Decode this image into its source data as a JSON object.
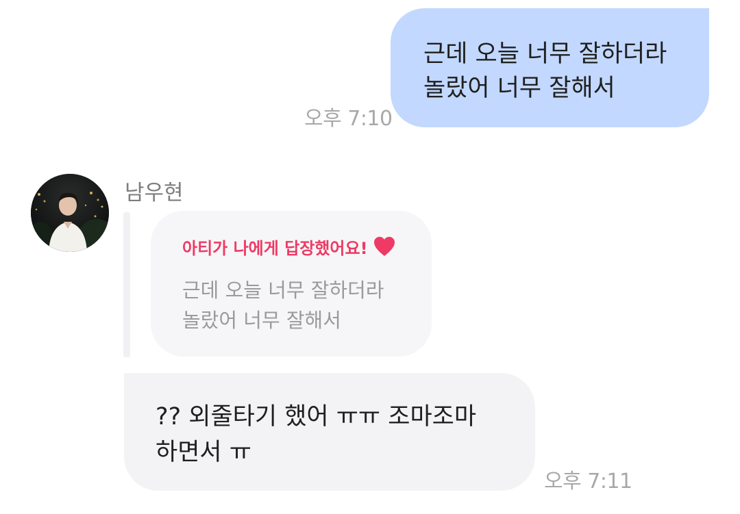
{
  "outgoing_message": {
    "lines": [
      "근데 오늘 너무 잘하더라",
      "놀랐어 너무 잘해서"
    ],
    "time": "오후 7:10",
    "bubble_color": "#c2d8fe"
  },
  "incoming": {
    "sender_name": "남우현",
    "avatar_icon": "profile-photo",
    "reply_quote": {
      "header": "아티가 나에게 답장했어요!",
      "header_color": "#ee3a64",
      "heart_icon": "heart-icon",
      "lines": [
        "근데 오늘 너무 잘하더라",
        "놀랐어 너무 잘해서"
      ]
    },
    "message": {
      "lines": [
        "?? 외줄타기 했어 ㅠㅠ 조마조마",
        "하면서 ㅠ"
      ],
      "time": "오후 7:11",
      "bubble_color": "#f3f3f5"
    }
  }
}
